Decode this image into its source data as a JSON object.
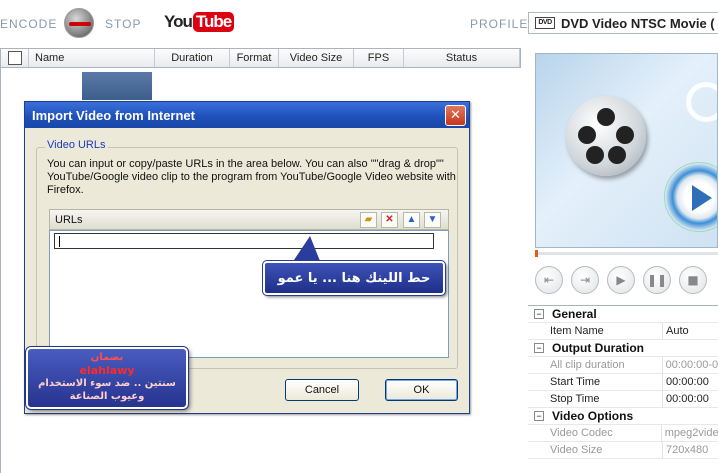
{
  "toolbar": {
    "encode_label": "ENCODE",
    "stop_label": "STOP",
    "youtube_logo": {
      "you": "You",
      "tube": "Tube"
    }
  },
  "profile": {
    "label": "PROFILE:",
    "value": "DVD Video NTSC Movie (",
    "icon_text": "DVD"
  },
  "file_list": {
    "columns": [
      "Name",
      "Duration",
      "Format",
      "Video Size",
      "FPS",
      "Status"
    ]
  },
  "properties": {
    "sections": [
      {
        "title": "General",
        "rows": [
          {
            "key": "Item Name",
            "value": "Auto",
            "dim": false
          }
        ]
      },
      {
        "title": "Output Duration",
        "rows": [
          {
            "key": "All clip duration",
            "value": "00:00:00-0",
            "dim": true
          },
          {
            "key": "Start Time",
            "value": "00:00:00",
            "dim": false
          },
          {
            "key": "Stop Time",
            "value": "00:00:00",
            "dim": false
          }
        ]
      },
      {
        "title": "Video Options",
        "rows": [
          {
            "key": "Video Codec",
            "value": "mpeg2vide",
            "dim": true
          },
          {
            "key": "Video Size",
            "value": "720x480",
            "dim": true
          }
        ]
      }
    ]
  },
  "dialog": {
    "title": "Import Video from Internet",
    "close_glyph": "✕",
    "group_title": "Video URLs",
    "description": "You can input or copy/paste URLs in the area below. You can also \"\"drag & drop\"\" YouTube/Google video clip to the program from YouTube/Google Video website with Firefox.",
    "urls_label": "URLs",
    "url_value": "",
    "cancel_label": "Cancel",
    "ok_label": "OK"
  },
  "callout": {
    "text": "حط اللينك هنا ... يا عمو"
  },
  "credit": {
    "line1": "بضمان",
    "line2": "elahlawy",
    "line3": "سنتين .. ضد سوء الاستخدام وعيوب الصناعة"
  },
  "colors": {
    "title_bar": "#1e4fb8",
    "callout": "#2a3d9c",
    "dialog_bg": "#ece9d8",
    "group_title": "#1a3bbd"
  }
}
